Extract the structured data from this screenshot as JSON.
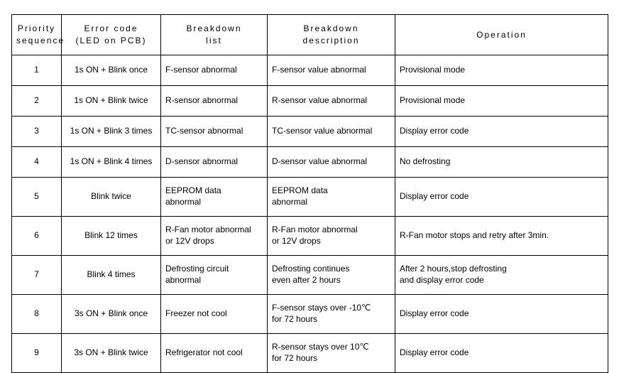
{
  "headers": {
    "priority": "Priority\nsequence",
    "errorCode": "Error code\n(LED on PCB)",
    "breakdownList": "Breakdown\nlist",
    "breakdownDesc": "Breakdown\ndescription",
    "operation": "Operation"
  },
  "rows": [
    {
      "priority": "1",
      "errorCode": "1s ON + Blink once",
      "breakdownList": "F-sensor abnormal",
      "breakdownDesc": "F-sensor value abnormal",
      "operation": "Provisional mode",
      "tall": false
    },
    {
      "priority": "2",
      "errorCode": "1s ON + Blink twice",
      "breakdownList": "R-sensor abnormal",
      "breakdownDesc": "R-sensor value abnormal",
      "operation": "Provisional mode",
      "tall": false
    },
    {
      "priority": "3",
      "errorCode": "1s ON + Blink 3 times",
      "breakdownList": "TC-sensor abnormal",
      "breakdownDesc": "TC-sensor value abnormal",
      "operation": "Display error code",
      "tall": false
    },
    {
      "priority": "4",
      "errorCode": "1s ON + Blink 4 times",
      "breakdownList": "D-sensor abnormal",
      "breakdownDesc": "D-sensor value abnormal",
      "operation": "No defrosting",
      "tall": false
    },
    {
      "priority": "5",
      "errorCode": "Blink twice",
      "breakdownList": "EEPROM data\nabnormal",
      "breakdownDesc": "EEPROM data\nabnormal",
      "operation": "Display error code",
      "tall": true
    },
    {
      "priority": "6",
      "errorCode": "Blink 12 times",
      "breakdownList": "R-Fan motor abnormal\nor 12V drops",
      "breakdownDesc": "R-Fan motor abnormal\nor 12V drops",
      "operation": "R-Fan motor stops and retry after 3min.",
      "tall": true
    },
    {
      "priority": "7",
      "errorCode": "Blink 4 times",
      "breakdownList": "Defrosting circuit\nabnormal",
      "breakdownDesc": "Defrosting continues\neven after 2 hours",
      "operation": "After 2 hours,stop defrosting\nand display error code",
      "tall": true
    },
    {
      "priority": "8",
      "errorCode": "3s ON + Blink once",
      "breakdownList": "Freezer not cool",
      "breakdownDesc": "F-sensor stays over -10℃\nfor 72 hours",
      "operation": "Display error code",
      "tall": true
    },
    {
      "priority": "9",
      "errorCode": "3s ON + Blink twice",
      "breakdownList": "Refrigerator not cool",
      "breakdownDesc": "R-sensor stays over 10℃\nfor 72 hours",
      "operation": "Display error code",
      "tall": true
    }
  ]
}
